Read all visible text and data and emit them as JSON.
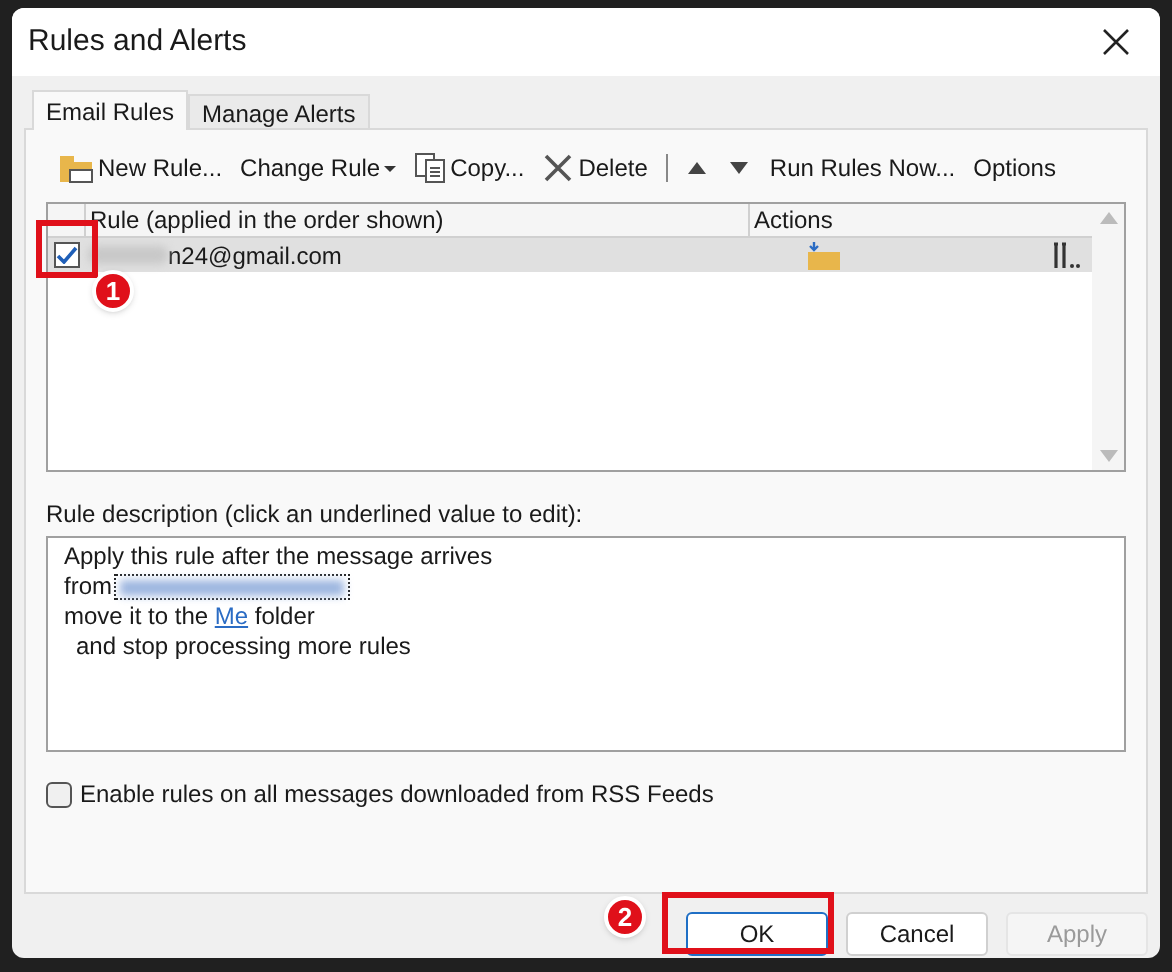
{
  "window": {
    "title": "Rules and Alerts"
  },
  "tabs": [
    {
      "label": "Email Rules",
      "selected": true
    },
    {
      "label": "Manage Alerts",
      "selected": false
    }
  ],
  "toolbar": [
    {
      "kind": "new",
      "label": "New Rule..."
    },
    {
      "kind": "dropdown",
      "label": "Change Rule"
    },
    {
      "kind": "copy",
      "label": "Copy..."
    },
    {
      "kind": "delete",
      "label": "Delete"
    },
    {
      "kind": "separator"
    },
    {
      "kind": "up"
    },
    {
      "kind": "down"
    },
    {
      "kind": "plain",
      "label": "Run Rules Now..."
    },
    {
      "kind": "plain",
      "label": "Options"
    }
  ],
  "rules_table": {
    "columns": [
      "Rule (applied in the order shown)",
      "Actions"
    ],
    "rows": [
      {
        "rule": "n24@gmail.com",
        "checked": true,
        "selected": true
      }
    ]
  },
  "description": {
    "label": "Rule description (click an underlined value to edit):",
    "lines": [
      {
        "kind": "text",
        "text": "Apply this rule after the message arrives"
      },
      {
        "kind": "redacted",
        "text": "from"
      },
      {
        "kind": "link",
        "before": "move it to the ",
        "link": "Me",
        "after": " folder"
      },
      {
        "kind": "indented",
        "text": "and stop processing more rules"
      }
    ]
  },
  "rss_option": {
    "label": "Enable rules on all messages downloaded from RSS Feeds",
    "checked": false
  },
  "buttons": [
    {
      "label": "OK",
      "default": true,
      "disabled": false
    },
    {
      "label": "Cancel",
      "default": false,
      "disabled": false
    },
    {
      "label": "Apply",
      "default": false,
      "disabled": true
    }
  ],
  "annotations": [
    {
      "label": "1"
    },
    {
      "label": "2"
    }
  ]
}
